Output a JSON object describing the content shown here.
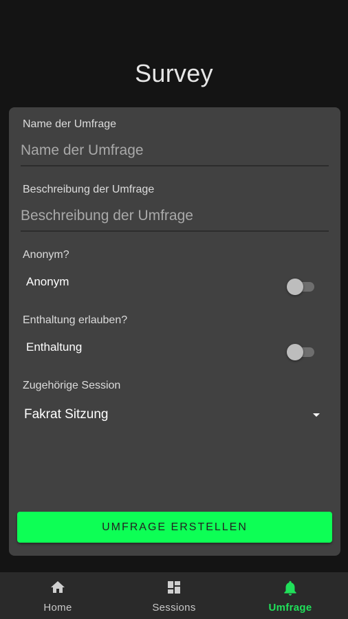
{
  "page": {
    "title": "Survey"
  },
  "form": {
    "name_label": "Name der Umfrage",
    "name_placeholder": "Name der Umfrage",
    "description_label": "Beschreibung der Umfrage",
    "description_placeholder": "Beschreibung der Umfrage",
    "anonymous_section": "Anonym?",
    "anonymous_toggle_label": "Anonym",
    "anonymous_value": false,
    "abstention_section": "Enthaltung erlauben?",
    "abstention_toggle_label": "Enthaltung",
    "abstention_value": false,
    "session_section": "Zugehörige Session",
    "session_selected": "Fakrat Sitzung",
    "submit_label": "UMFRAGE ERSTELLEN"
  },
  "nav": {
    "items": [
      {
        "label": "Home",
        "icon": "home-icon",
        "active": false
      },
      {
        "label": "Sessions",
        "icon": "dashboard-icon",
        "active": false
      },
      {
        "label": "Umfrage",
        "icon": "bell-icon",
        "active": true
      }
    ]
  },
  "colors": {
    "background": "#141414",
    "card": "#414141",
    "accent": "#0dff55",
    "nav_active": "#20e05a",
    "nav_bar": "#2a2a2a"
  }
}
